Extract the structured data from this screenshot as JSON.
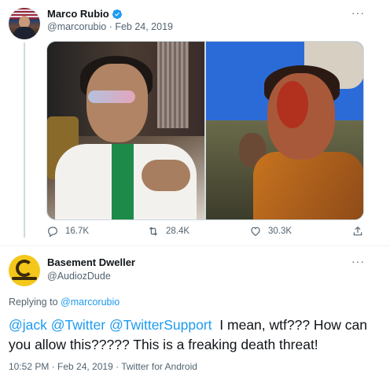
{
  "tweet1": {
    "display_name": "Marco Rubio",
    "handle_date": "@marcorubio · Feb 24, 2019",
    "more": "···",
    "actions": {
      "replies": "16.7K",
      "retweets": "28.4K",
      "likes": "30.3K"
    }
  },
  "tweet2": {
    "display_name": "Basement Dweller",
    "handle": "@AudiozDude",
    "more": "···",
    "replying_prefix": "Replying to ",
    "replying_to": "@marcorubio",
    "mentions": [
      "@jack",
      "@Twitter",
      "@TwitterSupport"
    ],
    "text": "I mean, wtf??? How can you allow this????? This is a freaking death threat!",
    "meta": "10:52 PM · Feb 24, 2019 · Twitter for Android"
  },
  "colors": {
    "link": "#1d9bf0",
    "muted": "#536471",
    "text": "#0f1419",
    "verified": "#1d9bf0"
  }
}
